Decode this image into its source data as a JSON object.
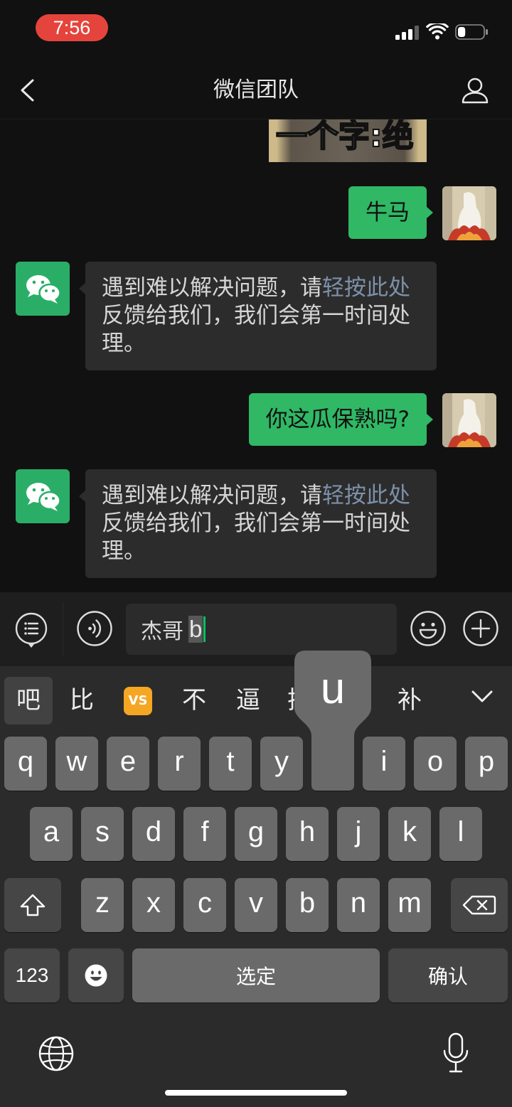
{
  "colors": {
    "page_background": "#111111",
    "bubble_self": "#30b865",
    "bubble_other": "#2c2c2c",
    "link_text": "#7d90a9",
    "time_pill": "#e5443c",
    "wechat_green": "#2aae67",
    "input_cursor": "#07c160",
    "keyboard_background": "#2b2b2b",
    "letter_key": "#6a6a6a",
    "function_key": "#464646",
    "vs_emoji": "#f5a623"
  },
  "status_bar": {
    "time": "7:56",
    "signal_bars_active": 3,
    "signal_bars_total": 4,
    "battery_level": 0.3,
    "icons": [
      "cellular-signal-icon",
      "wifi-icon",
      "battery-icon"
    ]
  },
  "nav": {
    "title": "微信团队",
    "back_icon": "chevron-left-icon",
    "profile_icon": "person-icon"
  },
  "chat": {
    "sticker_text": "一个字:绝",
    "messages": [
      {
        "avatar_icon": "user-photo-icon",
        "text": "牛马"
      },
      {
        "avatar_icon": "wechat-logo-icon",
        "text_before": "遇到难以解决问题，请",
        "link": "轻按此处",
        "text_after": "反馈给我们，我们会第一时间处理。"
      },
      {
        "avatar_icon": "user-photo-icon",
        "text": "你这瓜保熟吗?"
      },
      {
        "avatar_icon": "wechat-logo-icon",
        "text_before": "遇到难以解决问题，请",
        "link": "轻按此处",
        "text_after": "反馈给我们，我们会第一时间处理。"
      }
    ]
  },
  "input_bar": {
    "icons": [
      "list-menu-icon",
      "voice-icon",
      "emoji-icon",
      "plus-icon"
    ],
    "text": "杰哥",
    "composing_text": "b"
  },
  "keyboard": {
    "candidates": [
      "吧",
      "比",
      "VS",
      "不",
      "逼",
      "把",
      "补"
    ],
    "selected_candidate_index": 0,
    "collapse_icon": "chevron-down-icon",
    "rows": [
      [
        "q",
        "w",
        "e",
        "r",
        "t",
        "y",
        "u",
        "i",
        "o",
        "p"
      ],
      [
        "a",
        "s",
        "d",
        "f",
        "g",
        "h",
        "j",
        "k",
        "l"
      ],
      [
        "z",
        "x",
        "c",
        "v",
        "b",
        "n",
        "m"
      ]
    ],
    "pressed_key": "u",
    "shift_icon": "shift-icon",
    "delete_icon": "backspace-icon",
    "numbers_label": "123",
    "emoji_icon": "emoji-key-icon",
    "space_label": "选定",
    "return_label": "确认",
    "globe_icon": "globe-icon",
    "dictation_icon": "microphone-icon"
  }
}
